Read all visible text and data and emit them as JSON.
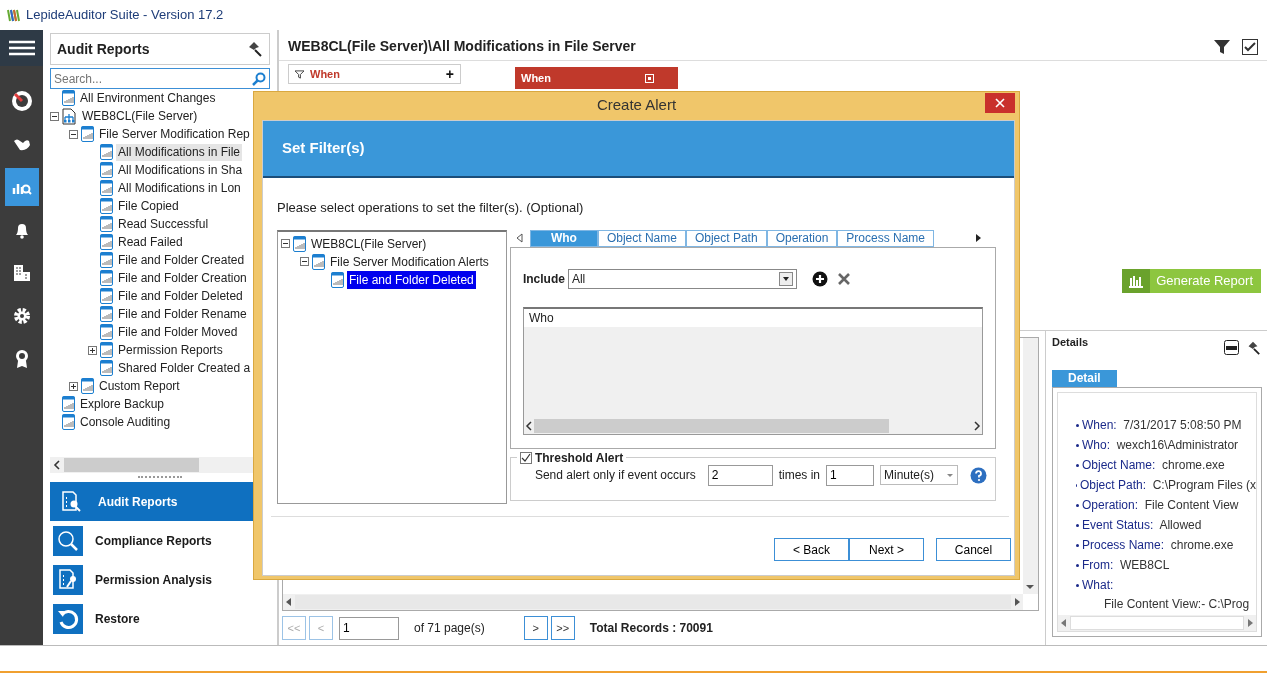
{
  "window": {
    "title": "LepideAuditor Suite - Version 17.2"
  },
  "rail": [
    {
      "kind": "radar",
      "selected": false
    },
    {
      "kind": "hand",
      "selected": false
    },
    {
      "kind": "chart-search",
      "selected": true
    },
    {
      "kind": "bell",
      "selected": false
    },
    {
      "kind": "building",
      "selected": false
    },
    {
      "kind": "gear",
      "selected": false
    },
    {
      "kind": "award",
      "selected": false
    }
  ],
  "sidebar": {
    "title": "Audit Reports",
    "search": {
      "placeholder": "Search..."
    },
    "tree": [
      {
        "label": "All Environment Changes",
        "kind": "report",
        "selected": false
      },
      {
        "label": "WEB8CL(File Server)",
        "kind": "server",
        "selected": false,
        "expanded": true,
        "children": [
          {
            "label": "File Server Modification Rep",
            "kind": "report",
            "selected": false,
            "expanded": true,
            "children": [
              {
                "label": "All Modifications in File",
                "kind": "report",
                "selected": true
              },
              {
                "label": "All Modifications in Sha",
                "kind": "report",
                "selected": false
              },
              {
                "label": "All Modifications in Lon",
                "kind": "report",
                "selected": false
              },
              {
                "label": "File Copied",
                "kind": "report",
                "selected": false
              },
              {
                "label": "Read Successful",
                "kind": "report",
                "selected": false
              },
              {
                "label": "Read Failed",
                "kind": "report",
                "selected": false
              },
              {
                "label": "File and Folder Created",
                "kind": "report",
                "selected": false
              },
              {
                "label": "File and Folder Creation",
                "kind": "report",
                "selected": false
              },
              {
                "label": "File and Folder Deleted",
                "kind": "report",
                "selected": false
              },
              {
                "label": "File and Folder Rename",
                "kind": "report",
                "selected": false
              },
              {
                "label": "File and Folder Moved",
                "kind": "report",
                "selected": false
              },
              {
                "label": "Permission Reports",
                "kind": "report",
                "selected": false,
                "expanded": false
              },
              {
                "label": "Shared Folder Created a",
                "kind": "report",
                "selected": false
              }
            ]
          },
          {
            "label": "Custom Report",
            "kind": "report",
            "selected": false,
            "expanded": false
          }
        ]
      },
      {
        "label": "Explore Backup",
        "kind": "report",
        "selected": false
      },
      {
        "label": "Console Auditing",
        "kind": "report",
        "selected": false
      }
    ],
    "nav": [
      {
        "label": "Audit Reports",
        "kind": "audit",
        "selected": true
      },
      {
        "label": "Compliance Reports",
        "kind": "compliance",
        "selected": false
      },
      {
        "label": "Permission Analysis",
        "kind": "permission",
        "selected": false
      },
      {
        "label": "Restore",
        "kind": "restore",
        "selected": false
      }
    ]
  },
  "report": {
    "title": "WEB8CL(File Server)\\All Modifications in File Server",
    "filter_chip": {
      "label": "When",
      "button": "+"
    },
    "when_block": {
      "label": "When"
    },
    "generate_button": "Generate Report",
    "pager": {
      "first": "<<",
      "prev": "<",
      "page": "1",
      "of": "of 71 page(s)",
      "next": ">",
      "last": ">>",
      "total": "Total Records : 70091"
    }
  },
  "details": {
    "title": "Details",
    "tab": "Detail",
    "items": [
      {
        "label": "When:",
        "value": "7/31/2017 5:08:50 PM"
      },
      {
        "label": "Who:",
        "value": "wexch16\\Administrator"
      },
      {
        "label": "Object Name:",
        "value": "chrome.exe"
      },
      {
        "label": "Object Path:",
        "value": "C:\\Program Files (x"
      },
      {
        "label": "Operation:",
        "value": "File Content View"
      },
      {
        "label": "Event Status:",
        "value": "Allowed"
      },
      {
        "label": "Process Name:",
        "value": "chrome.exe"
      },
      {
        "label": "From:",
        "value": "WEB8CL"
      },
      {
        "label": "What:"
      }
    ],
    "what_text": "File Content View:- C:\\Prog"
  },
  "dialog": {
    "title": "Create Alert",
    "header": "Set Filter(s)",
    "instruction": "Please select operations to set the filter(s). (Optional)",
    "tree": [
      {
        "label": "WEB8CL(File Server)",
        "selected": false,
        "expanded": true,
        "children": [
          {
            "label": "File Server Modification Alerts",
            "selected": false,
            "expanded": true,
            "children": [
              {
                "label": "File and Folder Deleted",
                "selected": true
              }
            ]
          }
        ]
      }
    ],
    "tabs": [
      {
        "label": "Who",
        "selected": true
      },
      {
        "label": "Object Name",
        "selected": false
      },
      {
        "label": "Object Path",
        "selected": false
      },
      {
        "label": "Operation",
        "selected": false
      },
      {
        "label": "Process Name",
        "selected": false
      }
    ],
    "include": {
      "label": "Include",
      "value": "All"
    },
    "list_header": "Who",
    "threshold": {
      "label": "Threshold Alert",
      "checked": true,
      "text": "Send alert only if event occurs",
      "count": "2",
      "times_in": "times in",
      "period": "1",
      "unit": "Minute(s)"
    },
    "buttons": [
      {
        "label": "< Back",
        "kind": "back"
      },
      {
        "label": "Next >",
        "kind": "next"
      },
      {
        "label": "Cancel",
        "kind": "cancel"
      }
    ]
  }
}
